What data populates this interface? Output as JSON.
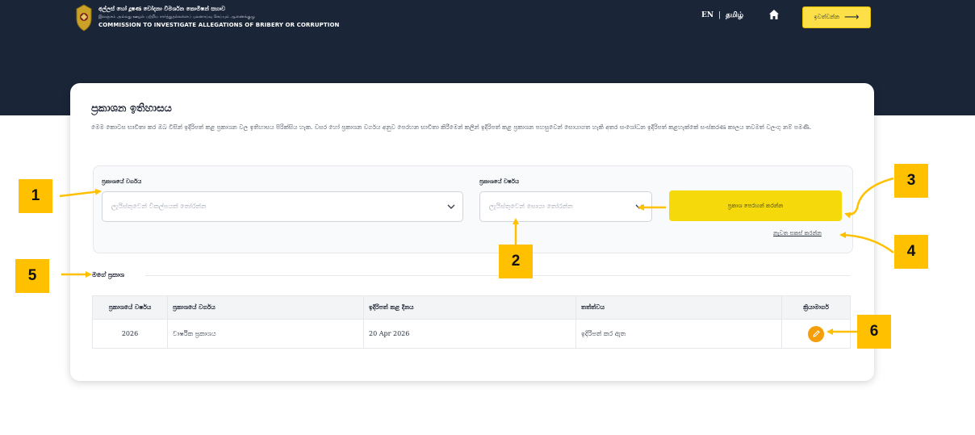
{
  "header": {
    "org_si": "අල්ලස් හෝ දූෂණ චෝදනා විමර්ශන කොමිෂන් සභාව",
    "org_ta": "இலஞ்சம் அல்லது ஊழல் பற்றிய சார்த்துதல்களைப் புலனாய்வு செய்யும் ஆணைக்குழு",
    "org_en": "COMMISSION TO INVESTIGATE ALLEGATIONS OF BRIBERY OR CORRUPTION",
    "lang_en": "EN",
    "lang_separator": "|",
    "lang_ta": "தமிழ்",
    "home_icon": "home-icon",
    "logout_label": "ඉවත්වන්න",
    "logout_arrow": "⟶"
  },
  "page": {
    "title": "ප්‍රකාශන ඉතිහාසය",
    "description": "මෙම කොටස භාවිතා කර ඔබ විසින් ඉදිරිපත් කළ ප්‍රකාශන වල ඉතිහාසය පිරික්සිය හැක. වසර හෝ ප්‍රකාශන වර්ගය අනුව පෙරහන භාවිතා කිරීමෙන් කලින් ඉදිරිපත් කළ ප්‍රකාශන පහසුවෙන් සොයාගත හැකි අතර සංශෝධන ඉදිරිපත් කළහැක්කේ සංස්කරණ කාලය තවමත් වලංගු නම් පමණි."
  },
  "filters": {
    "type_label": "ප්‍රකාශයේ වර්ගය",
    "type_placeholder": "ලැයිස්තුවෙන් විකල්පයක් තෝරන්න",
    "year_label": "ප්‍රකාශයේ වර්ෂය",
    "year_placeholder": "ලැයිස්තුවෙන් සොයා තෝරන්න",
    "filter_button": "ප්‍රකාශ පෙරහන් කරන්න",
    "reset_link": "නැවත සකස් කරන්න"
  },
  "my_declarations": {
    "title": "මගේ ප්‍රකාශ",
    "columns": [
      "ප්‍රකාශයේ වර්ෂය",
      "ප්‍රකාශයේ වර්ගය",
      "ඉදිරිපත් කළ දිනය",
      "තත්ත්වය",
      "ක්‍රියාමාර්ග"
    ],
    "rows": [
      {
        "year": "2026",
        "type": "වාර්ෂික ප්‍රකාශය",
        "date": "20 Apr 2026",
        "status": "ඉදිරිපත් කර ඇත",
        "action_icon": "edit-icon"
      }
    ]
  },
  "callouts": {
    "n1": "1",
    "n2": "2",
    "n3": "3",
    "n4": "4",
    "n5": "5",
    "n6": "6",
    "color": "#ffc000"
  },
  "colors": {
    "header_bg": "#1a2538",
    "accent_yellow": "#f5d90a",
    "edit_orange": "#f59e0b"
  }
}
